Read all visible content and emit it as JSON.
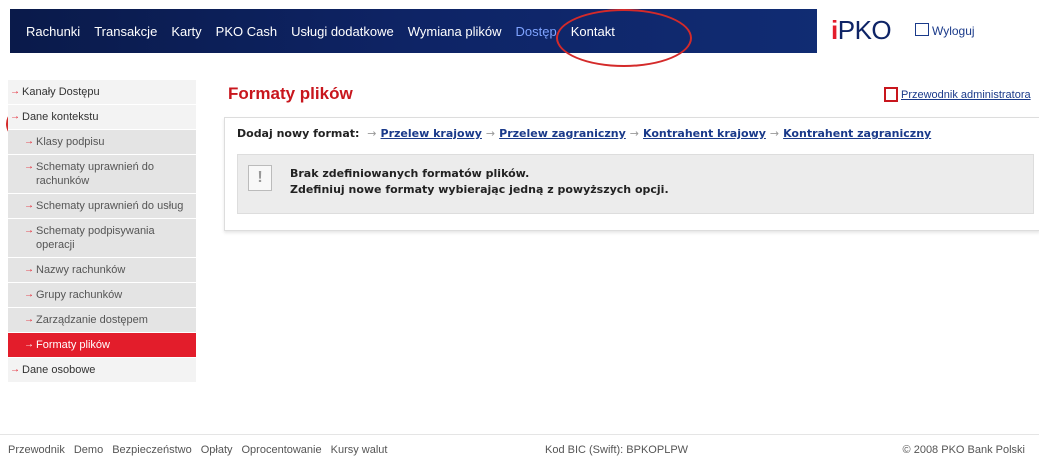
{
  "nav": {
    "items": [
      "Rachunki",
      "Transakcje",
      "Karty",
      "PKO Cash",
      "Usługi dodatkowe",
      "Wymiana plików",
      "Dostęp",
      "Kontakt"
    ],
    "active_index": 6,
    "logo": "iPKO",
    "logout_label": "Wyloguj"
  },
  "sidebar": {
    "items": [
      {
        "label": "Kanały Dostępu",
        "level": 1
      },
      {
        "label": "Dane kontekstu",
        "level": 1
      },
      {
        "label": "Klasy podpisu",
        "level": 2
      },
      {
        "label": "Schematy uprawnień do rachunków",
        "level": 2
      },
      {
        "label": "Schematy uprawnień do usług",
        "level": 2
      },
      {
        "label": "Schematy podpisywania operacji",
        "level": 2
      },
      {
        "label": "Nazwy rachunków",
        "level": 2
      },
      {
        "label": "Grupy rachunków",
        "level": 2
      },
      {
        "label": "Zarządzanie dostępem",
        "level": 2
      },
      {
        "label": "Formaty plików",
        "level": 2,
        "active": true
      },
      {
        "label": "Dane osobowe",
        "level": 1
      }
    ]
  },
  "main": {
    "title": "Formaty plików",
    "guide_link": "Przewodnik administratora",
    "add_label": "Dodaj nowy format:",
    "format_links": [
      "Przelew krajowy",
      "Przelew zagraniczny",
      "Kontrahent krajowy",
      "Kontrahent zagraniczny"
    ],
    "message_line1": "Brak zdefiniowanych formatów plików.",
    "message_line2": "Zdefiniuj nowe formaty wybierając jedną z powyższych opcji.",
    "message_icon": "!"
  },
  "footer": {
    "links": [
      "Przewodnik",
      "Demo",
      "Bezpieczeństwo",
      "Opłaty",
      "Oprocentowanie",
      "Kursy walut"
    ],
    "bic": "Kod BIC (Swift): BPKOPLPW",
    "copyright": "© 2008 PKO Bank Polski"
  },
  "colors": {
    "brand_red": "#e31d2b",
    "nav_blue": "#0e2466",
    "annotation_red": "#d42a2a"
  }
}
